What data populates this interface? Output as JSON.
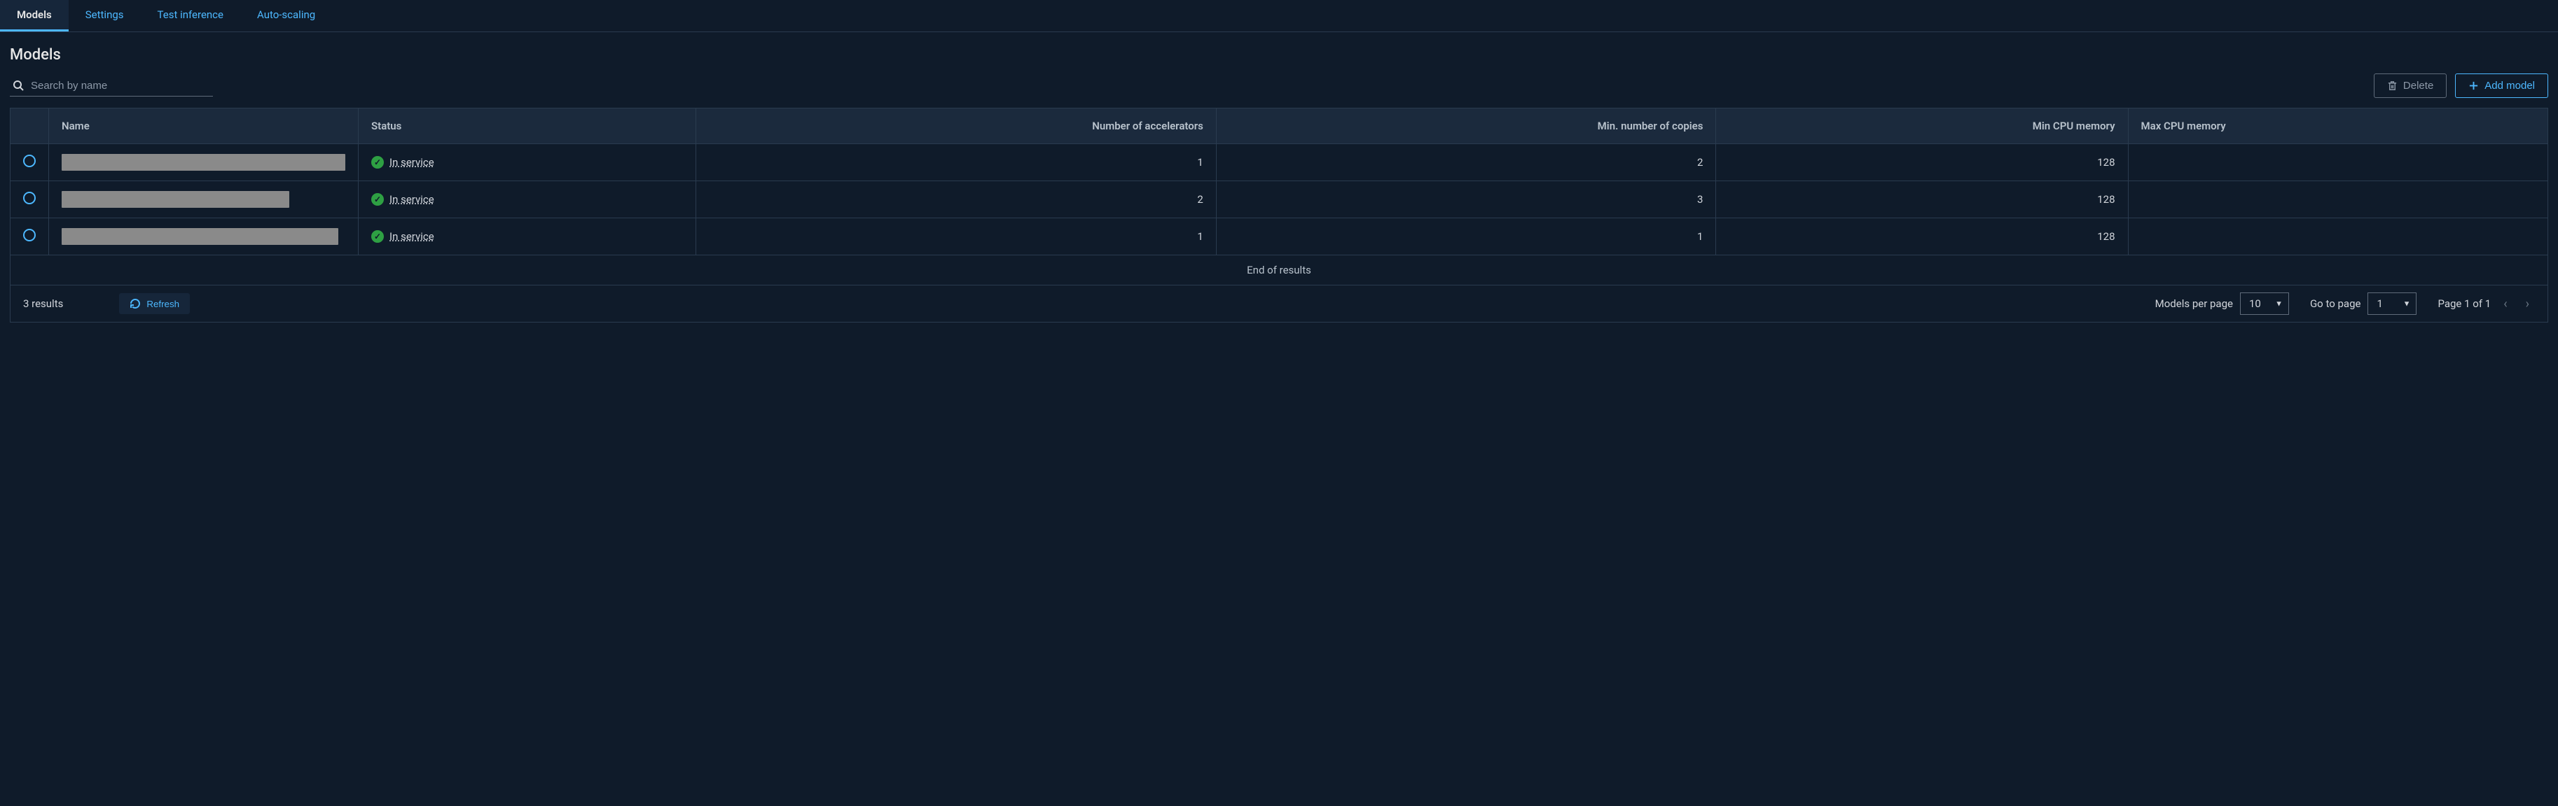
{
  "tabs": {
    "items": [
      {
        "label": "Models",
        "active": true
      },
      {
        "label": "Settings",
        "active": false
      },
      {
        "label": "Test inference",
        "active": false
      },
      {
        "label": "Auto-scaling",
        "active": false
      }
    ]
  },
  "heading": "Models",
  "search": {
    "placeholder": "Search by name"
  },
  "actions": {
    "delete_label": "Delete",
    "add_label": "Add model"
  },
  "table": {
    "columns": {
      "name": "Name",
      "status": "Status",
      "accelerators": "Number of accelerators",
      "min_copies": "Min. number of copies",
      "min_cpu_mem": "Min CPU memory",
      "max_cpu_mem": "Max CPU memory"
    },
    "rows": [
      {
        "name_redacted_width": 405,
        "status": "In service",
        "accelerators": 1,
        "min_copies": 2,
        "min_cpu_mem": 128,
        "max_cpu_mem": ""
      },
      {
        "name_redacted_width": 325,
        "status": "In service",
        "accelerators": 2,
        "min_copies": 3,
        "min_cpu_mem": 128,
        "max_cpu_mem": ""
      },
      {
        "name_redacted_width": 395,
        "status": "In service",
        "accelerators": 1,
        "min_copies": 1,
        "min_cpu_mem": 128,
        "max_cpu_mem": ""
      }
    ],
    "end_label": "End of results"
  },
  "footer": {
    "results_count": "3 results",
    "refresh_label": "Refresh",
    "per_page_label": "Models per page",
    "per_page_value": "10",
    "goto_label": "Go to page",
    "goto_value": "1",
    "page_summary": "Page 1 of 1"
  }
}
